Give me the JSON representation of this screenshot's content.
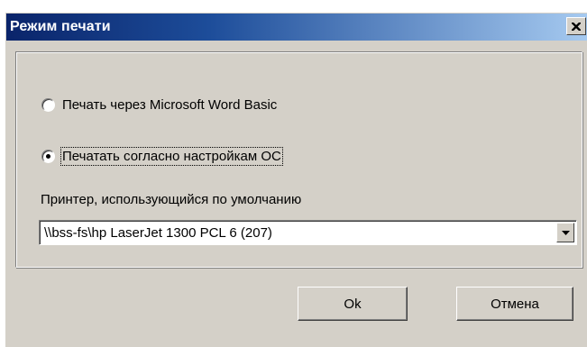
{
  "window": {
    "title": "Режим печати"
  },
  "options": {
    "word_basic_label": "Печать через Microsoft Word Basic",
    "os_settings_label": "Печатать согласно настройкам ОС",
    "selected": "os_settings"
  },
  "printer": {
    "label": "Принтер, использующийся по умолчанию",
    "value": "\\\\bss-fs\\hp LaserJet 1300 PCL 6 (207)"
  },
  "buttons": {
    "ok_label": "Ok",
    "cancel_label": "Отмена"
  },
  "colors": {
    "title_bar_start": "#0a246a",
    "title_bar_end": "#a6caf0",
    "face": "#d4d0c8"
  }
}
